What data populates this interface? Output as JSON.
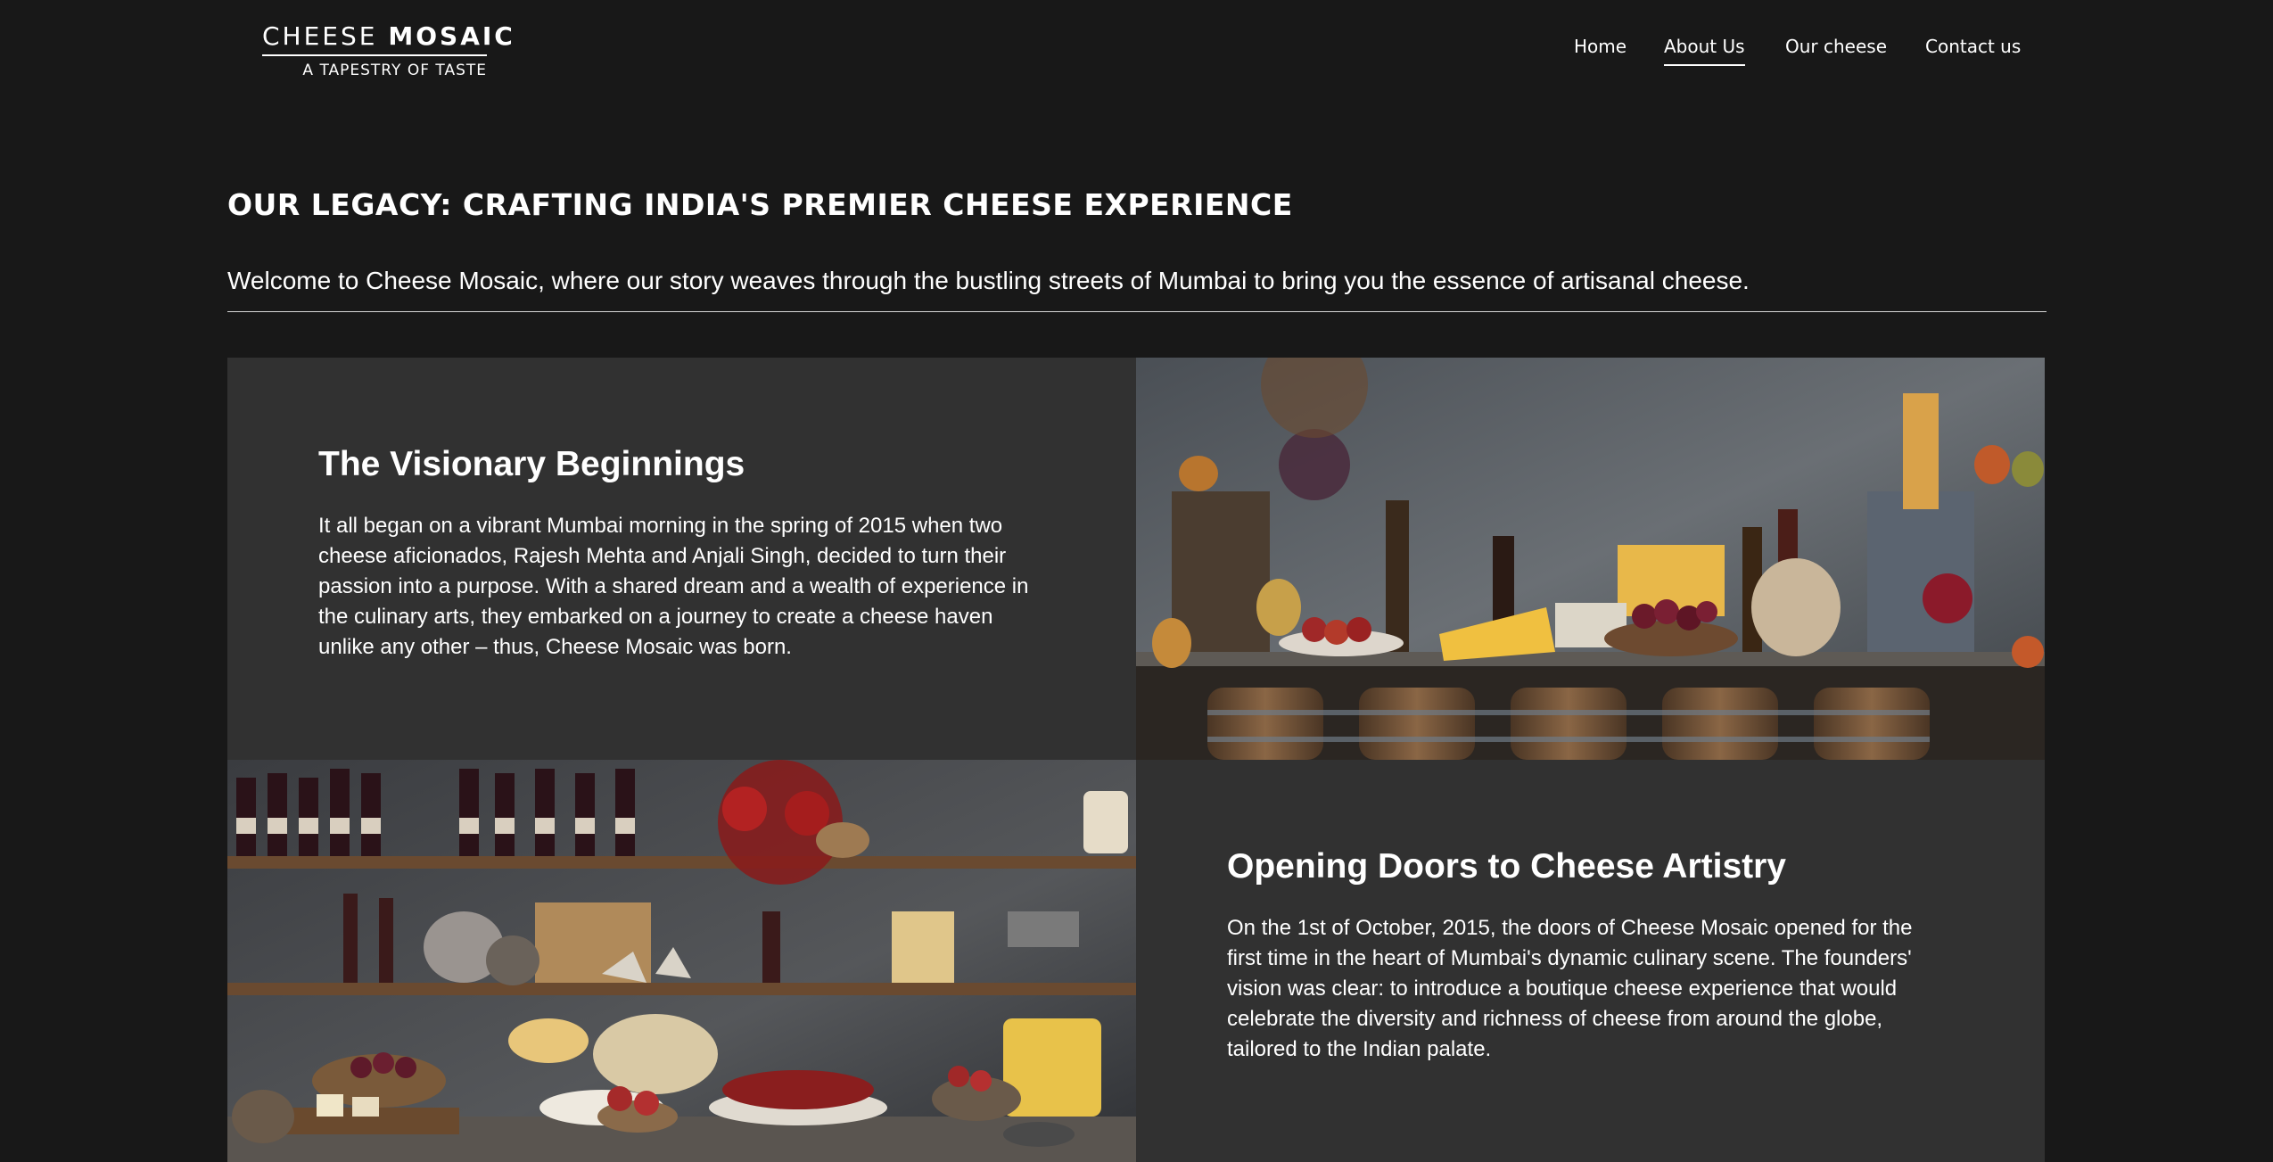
{
  "logo": {
    "title_light": "CHEESE",
    "title_bold": "MOSAIC",
    "tagline": "A TAPESTRY OF TASTE"
  },
  "nav": {
    "items": [
      {
        "label": "Home",
        "active": false
      },
      {
        "label": "About Us",
        "active": true
      },
      {
        "label": "Our cheese",
        "active": false
      },
      {
        "label": "Contact us",
        "active": false
      }
    ]
  },
  "intro": {
    "title": "OUR LEGACY: CRAFTING INDIA'S PREMIER CHEESE EXPERIENCE",
    "lead": "Welcome to Cheese Mosaic, where our story weaves through the bustling streets of Mumbai to bring you the essence of artisanal cheese."
  },
  "sections": [
    {
      "title": "The Visionary Beginnings",
      "body": "It all began on a vibrant Mumbai morning in the spring of 2015 when two cheese aficionados, Rajesh Mehta and Anjali Singh, decided to turn their passion into a purpose. With a shared dream and a wealth of experience in the culinary arts, they embarked on a journey to create a cheese haven unlike any other – thus, Cheese Mosaic was born."
    },
    {
      "title": "Opening Doors to Cheese Artistry",
      "body": "On the 1st of October, 2015, the doors of Cheese Mosaic opened for the first time in the heart of Mumbai's dynamic culinary scene. The founders' vision was clear: to introduce a boutique cheese experience that would celebrate the diversity and richness of cheese from around the globe, tailored to the Indian palate."
    }
  ],
  "colors": {
    "page_bg": "#181818",
    "panel_bg": "#313131",
    "text": "#ffffff"
  }
}
